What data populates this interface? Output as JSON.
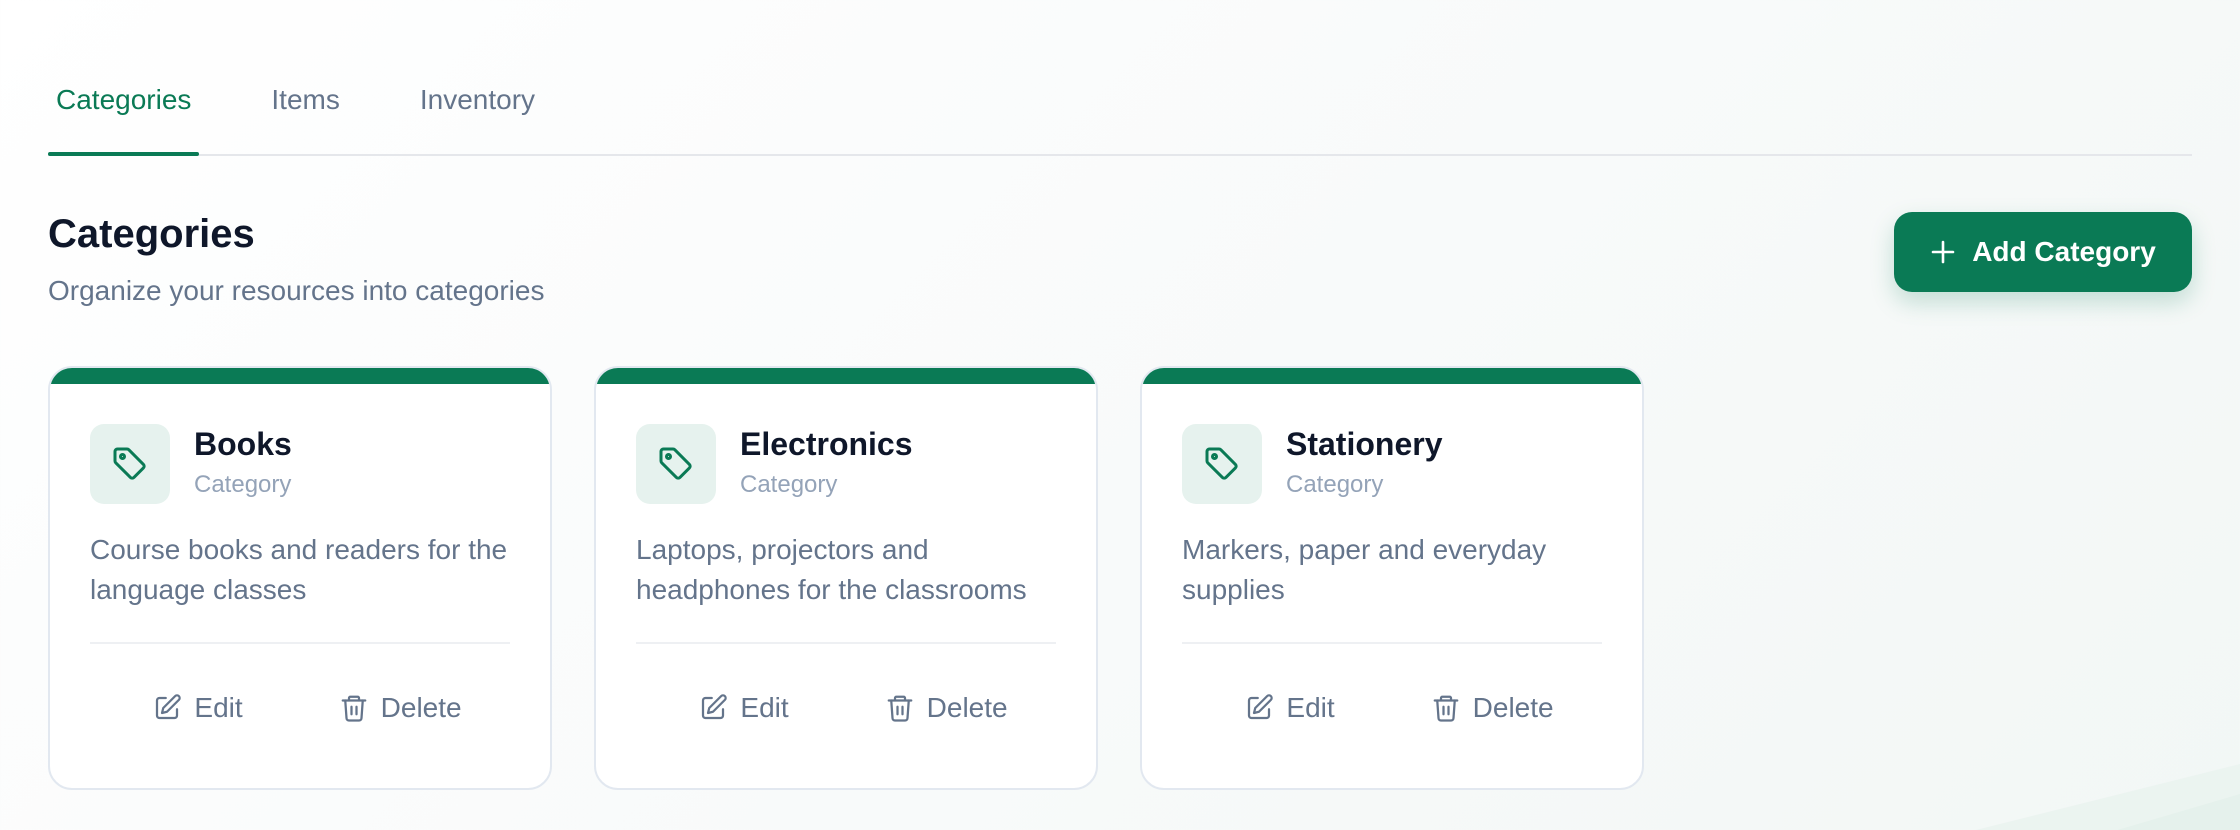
{
  "tabs": [
    {
      "label": "Categories",
      "active": true
    },
    {
      "label": "Items",
      "active": false
    },
    {
      "label": "Inventory",
      "active": false
    }
  ],
  "header": {
    "title": "Categories",
    "subtitle": "Organize your resources into categories",
    "add_button_label": "Add Category",
    "add_button_icon": "plus-icon"
  },
  "cards": [
    {
      "title": "Books",
      "type": "Category",
      "description": "Course books and readers for the language classes",
      "icon": "tag-icon",
      "edit_label": "Edit",
      "delete_label": "Delete"
    },
    {
      "title": "Electronics",
      "type": "Category",
      "description": "Laptops, projectors and headphones for the classrooms",
      "icon": "tag-icon",
      "edit_label": "Edit",
      "delete_label": "Delete"
    },
    {
      "title": "Stationery",
      "type": "Category",
      "description": "Markers, paper and everyday supplies",
      "icon": "tag-icon",
      "edit_label": "Edit",
      "delete_label": "Delete"
    }
  ],
  "colors": {
    "accent": "#0a7a55",
    "text_muted": "#64748b",
    "text_dark": "#0f172a"
  }
}
